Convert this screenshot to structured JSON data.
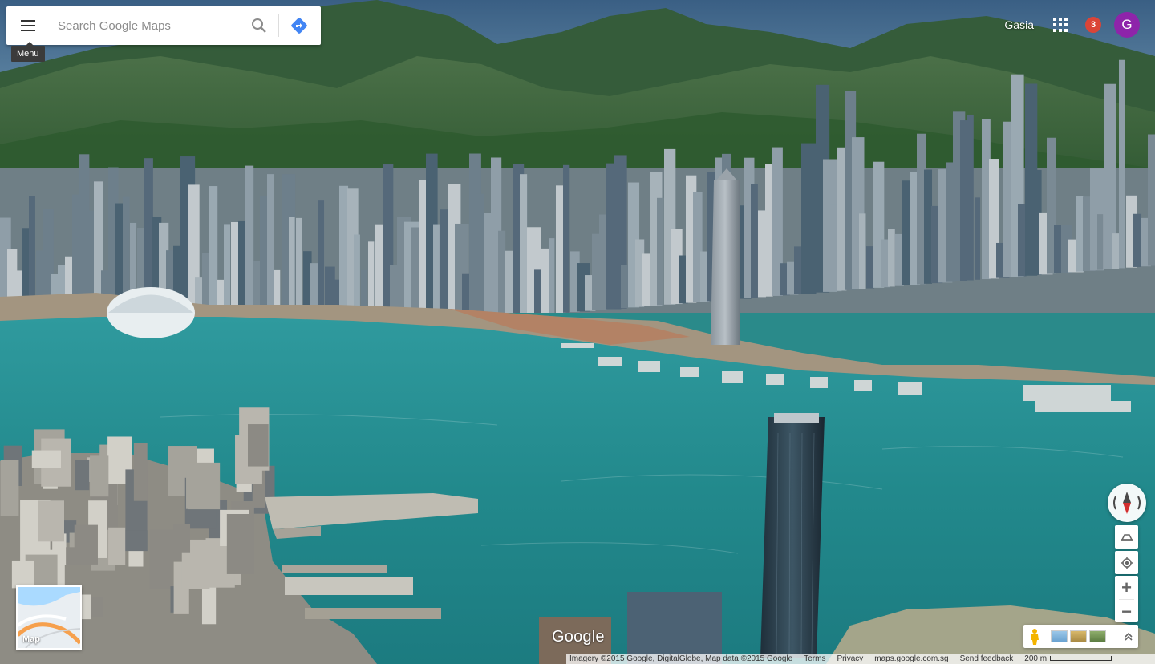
{
  "search": {
    "placeholder": "Search Google Maps",
    "menu_tooltip": "Menu"
  },
  "account": {
    "username": "Gasia",
    "notification_count": "3",
    "avatar_initial": "G",
    "avatar_color": "#8e24aa",
    "notification_color": "#db4437"
  },
  "icons": {
    "menu": "hamburger-icon",
    "search": "magnifier-icon",
    "directions": "directions-diamond-icon",
    "apps": "grid-icon",
    "compass": "compass-icon",
    "tilt": "tilt-icon",
    "my_location": "crosshair-icon",
    "pegman": "pegman-icon",
    "expand": "chevron-up-icon"
  },
  "zoom": {
    "in_label": "+",
    "out_label": "−"
  },
  "minimap": {
    "label": "Map"
  },
  "brand": {
    "logo_text": "Google"
  },
  "footer": {
    "attribution": "Imagery ©2015 Google, DigitalGlobe, Map data ©2015 Google",
    "terms": "Terms",
    "privacy": "Privacy",
    "domain": "maps.google.com.sg",
    "feedback": "Send feedback",
    "scale_label": "200 m"
  },
  "colors": {
    "water": "#2a8a8a",
    "mountains": "#2e5a2c",
    "accent_blue": "#4285f4"
  }
}
